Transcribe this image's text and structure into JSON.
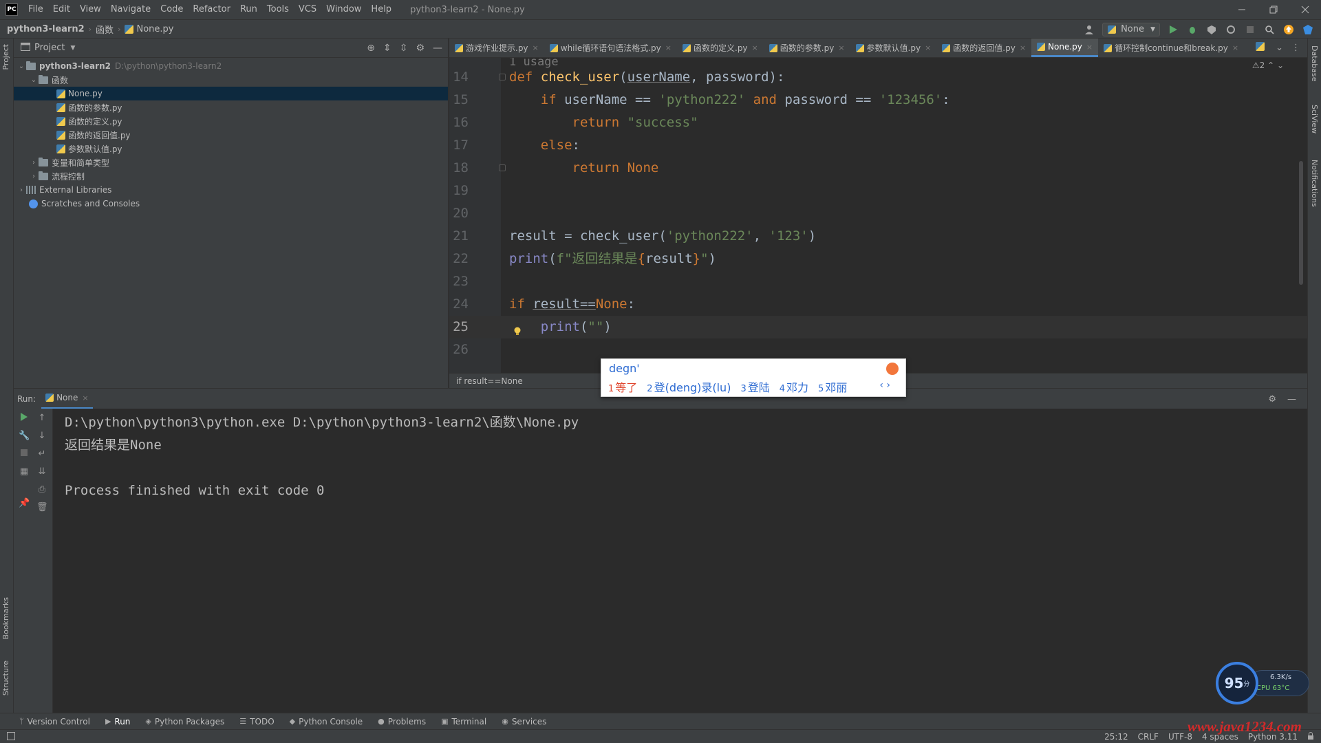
{
  "titlebar": {
    "logo": "PC",
    "menu": [
      "File",
      "Edit",
      "View",
      "Navigate",
      "Code",
      "Refactor",
      "Run",
      "Tools",
      "VCS",
      "Window",
      "Help"
    ],
    "window_title": "python3-learn2 - None.py"
  },
  "navbar": {
    "crumbs": [
      "python3-learn2",
      "函数",
      "None.py"
    ],
    "run_config": "None"
  },
  "project_panel": {
    "title": "Project",
    "tree": [
      {
        "label": "python3-learn2",
        "hint": "D:\\python\\python3-learn2",
        "type": "folder",
        "expanded": true
      },
      {
        "label": "函数",
        "type": "folder",
        "expanded": true
      },
      {
        "label": "None.py",
        "type": "py",
        "selected": true
      },
      {
        "label": "函数的参数.py",
        "type": "py"
      },
      {
        "label": "函数的定义.py",
        "type": "py"
      },
      {
        "label": "函数的返回值.py",
        "type": "py"
      },
      {
        "label": "参数默认值.py",
        "type": "py"
      },
      {
        "label": "变量和简单类型",
        "type": "folder",
        "expanded": false
      },
      {
        "label": "流程控制",
        "type": "folder",
        "expanded": false
      },
      {
        "label": "External Libraries",
        "type": "lib",
        "expanded": false
      },
      {
        "label": "Scratches and Consoles",
        "type": "scratch"
      }
    ]
  },
  "editor_tabs": [
    {
      "label": "游戏作业提示.py",
      "active": false
    },
    {
      "label": "while循环语句语法格式.py",
      "active": false
    },
    {
      "label": "函数的定义.py",
      "active": false
    },
    {
      "label": "函数的参数.py",
      "active": false
    },
    {
      "label": "参数默认值.py",
      "active": false
    },
    {
      "label": "函数的返回值.py",
      "active": false
    },
    {
      "label": "None.py",
      "active": true
    },
    {
      "label": "循环控制continue和break.py",
      "active": false
    }
  ],
  "editor": {
    "usage_hint": "1 usage",
    "warnings": "⚠2",
    "line_numbers": [
      "14",
      "15",
      "16",
      "17",
      "18",
      "19",
      "20",
      "21",
      "22",
      "23",
      "24",
      "25",
      "26"
    ],
    "current_line": "25",
    "breadcrumb": "if result==None"
  },
  "ime": {
    "input": "degn'",
    "candidates": [
      {
        "idx": "1",
        "text": "等了"
      },
      {
        "idx": "2",
        "text": "登(deng)录(lu)"
      },
      {
        "idx": "3",
        "text": "登陆"
      },
      {
        "idx": "4",
        "text": "邓力"
      },
      {
        "idx": "5",
        "text": "邓丽"
      }
    ],
    "pager": "‹ ›"
  },
  "run_panel": {
    "label": "Run:",
    "tab": "None",
    "console": [
      "D:\\python\\python3\\python.exe D:\\python\\python3-learn2\\函数\\None.py",
      "返回结果是None",
      "",
      "Process finished with exit code 0"
    ]
  },
  "bottom_bar": [
    {
      "label": "Version Control",
      "icon": "branch-icon",
      "glyph": "ᛘ"
    },
    {
      "label": "Run",
      "icon": "run-icon",
      "glyph": "▶",
      "active": true
    },
    {
      "label": "Python Packages",
      "icon": "packages-icon",
      "glyph": "◈"
    },
    {
      "label": "TODO",
      "icon": "todo-icon",
      "glyph": "☰"
    },
    {
      "label": "Python Console",
      "icon": "python-console-icon",
      "glyph": "◆"
    },
    {
      "label": "Problems",
      "icon": "problems-icon",
      "glyph": "●"
    },
    {
      "label": "Terminal",
      "icon": "terminal-icon",
      "glyph": "▣"
    },
    {
      "label": "Services",
      "icon": "services-icon",
      "glyph": "◉"
    }
  ],
  "status_bar": {
    "position": "25:12",
    "line_sep": "CRLF",
    "encoding": "UTF-8",
    "indent": "4 spaces",
    "interpreter": "Python 3.11"
  },
  "left_strip": {
    "project": "Project",
    "bookmarks": "Bookmarks",
    "structure": "Structure"
  },
  "right_strip": {
    "database": "Database",
    "sciview": "SciView",
    "notifications": "Notifications"
  },
  "speed_widget": {
    "score": "95",
    "unit": "分",
    "net": "6.3K/s",
    "cpu": "CPU 63°C"
  },
  "watermark": "www.java1234.com",
  "colors": {
    "accent": "#4a88c7",
    "keyword": "#cc7832",
    "string": "#6a8759",
    "function": "#ffc66d",
    "builtin": "#8888c6"
  }
}
